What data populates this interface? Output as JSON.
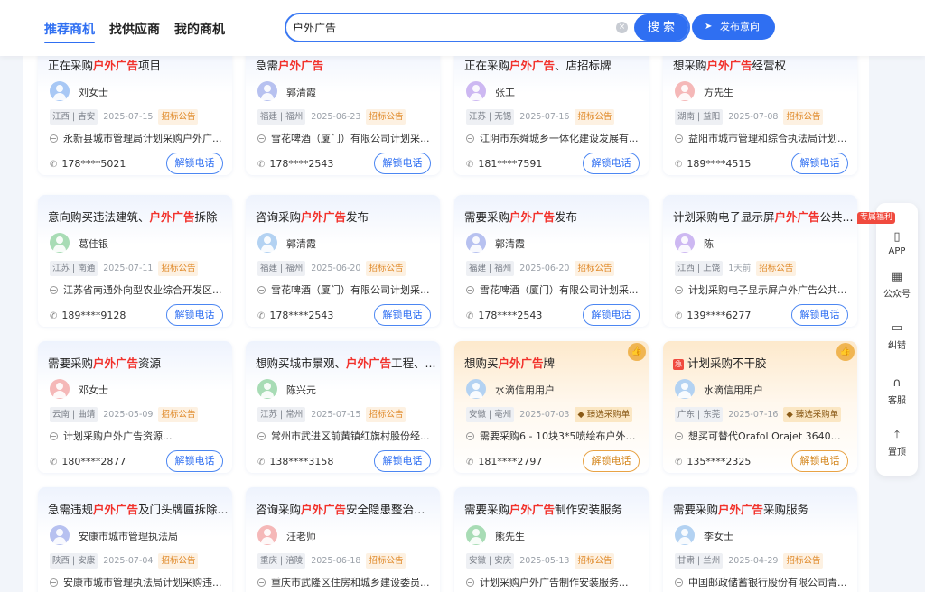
{
  "nav": {
    "tabs": [
      "推荐商机",
      "找供应商",
      "我的商机"
    ]
  },
  "search": {
    "value": "户外广告",
    "clear_icon": "×",
    "button_label": "搜 索"
  },
  "publish": {
    "label": "发布意向",
    "icon": "paper-plane-icon"
  },
  "keyword": "户外广告",
  "cards": [
    {
      "title_pre": "正在采购",
      "title_post": "项目",
      "name": "刘女士",
      "location": "江西 | 吉安",
      "date": "2025-07-15",
      "tag": "招标公告",
      "org": "永新县城市管理局计划采购户外广...",
      "phone": "178****5021",
      "button": "解锁电话",
      "avatar_color": "#a8c8f5"
    },
    {
      "title_pre": "急需",
      "title_post": "",
      "name": "郭清霞",
      "location": "福建 | 福州",
      "date": "2025-06-23",
      "tag": "招标公告",
      "org": "雪花啤酒（厦门）有限公司计划采...",
      "phone": "178****2543",
      "button": "解锁电话",
      "avatar_color": "#b7c1f0"
    },
    {
      "title_pre": "正在采购",
      "title_post": "、店招标牌",
      "name": "张工",
      "location": "江苏 | 无锡",
      "date": "2025-07-16",
      "tag": "招标公告",
      "org": "江阴市东舜城乡一体化建设发展有...",
      "phone": "181****7591",
      "button": "解锁电话",
      "avatar_color": "#cdb8f2"
    },
    {
      "title_pre": "想采购",
      "title_post": "经营权",
      "name": "方先生",
      "location": "湖南 | 益阳",
      "date": "2025-07-08",
      "tag": "招标公告",
      "org": "益阳市城市管理和综合执法局计划...",
      "phone": "189****4515",
      "button": "解锁电话",
      "avatar_color": "#f5b8b8"
    },
    {
      "title_pre": "意向购买违法建筑、",
      "title_post": "拆除",
      "name": "葛佳银",
      "location": "江苏 | 南通",
      "date": "2025-07-11",
      "tag": "招标公告",
      "org": "江苏省南通外向型农业综合开发区...",
      "phone": "189****9128",
      "button": "解锁电话",
      "avatar_color": "#a8dcb5"
    },
    {
      "title_pre": "咨询采购",
      "title_post": "发布",
      "name": "郭清霞",
      "location": "福建 | 福州",
      "date": "2025-06-20",
      "tag": "招标公告",
      "org": "雪花啤酒（厦门）有限公司计划采...",
      "phone": "178****2543",
      "button": "解锁电话",
      "avatar_color": "#b3d2f2"
    },
    {
      "title_pre": "需要采购",
      "title_post": "发布",
      "name": "郭清霞",
      "location": "福建 | 福州",
      "date": "2025-06-20",
      "tag": "招标公告",
      "org": "雪花啤酒（厦门）有限公司计划采...",
      "phone": "178****2543",
      "button": "解锁电话",
      "avatar_color": "#b7c1f0"
    },
    {
      "title_pre": "计划采购电子显示屏",
      "title_post": "公共...",
      "name": "陈",
      "location": "江西 | 上饶",
      "date": "1天前",
      "tag": "招标公告",
      "org": "计划采购电子显示屏户外广告公共...",
      "phone": "139****6277",
      "button": "解锁电话",
      "avatar_color": "#cdb8f2"
    },
    {
      "title_pre": "需要采购",
      "title_post": "资源",
      "name": "邓女士",
      "location": "云南 | 曲靖",
      "date": "2025-05-09",
      "tag": "招标公告",
      "org": "计划采购户外广告资源...",
      "phone": "180****2877",
      "button": "解锁电话",
      "avatar_color": "#f5b8b8"
    },
    {
      "title_pre": "想购买城市景观、",
      "title_post": "工程、...",
      "name": "陈兴元",
      "location": "江苏 | 常州",
      "date": "2025-07-15",
      "tag": "招标公告",
      "org": "常州市武进区前黄镇红旗村股份经...",
      "phone": "138****3158",
      "button": "解锁电话",
      "avatar_color": "#a8dcb5"
    },
    {
      "title_pre": "想购买",
      "title_post": "牌",
      "name": "水滴信用用户",
      "location": "安徽 | 亳州",
      "date": "2025-07-03",
      "tag": "臻选采购单",
      "org": "需要采购6 - 10块3*5喷绘布户外广...",
      "phone": "181****2797",
      "button": "解锁电话",
      "avatar_color": "#b3d2f2"
    },
    {
      "title_pre": "计划采购不干胶",
      "title_post": "",
      "name": "水滴信用用户",
      "location": "广东 | 东莞",
      "date": "2025-07-16",
      "tag": "臻选采购单",
      "org": "想买可替代Orafol Orajet 3640的不...",
      "phone": "135****2325",
      "button": "解锁电话",
      "avatar_color": "#b3d2f2"
    },
    {
      "title_pre": "急需违规",
      "title_post": "及门头牌匾拆除...",
      "name": "安康市城市管理执法局",
      "location": "陕西 | 安康",
      "date": "2025-07-04",
      "tag": "招标公告",
      "org": "安康市城市管理执法局计划采购违...",
      "phone": "",
      "button": "",
      "avatar_color": "#b7c1f0"
    },
    {
      "title_pre": "咨询采购",
      "title_post": "安全隐患整治工程",
      "name": "汪老师",
      "location": "重庆 | 涪陵",
      "date": "2025-06-18",
      "tag": "招标公告",
      "org": "重庆市武隆区住房和城乡建设委员...",
      "phone": "",
      "button": "",
      "avatar_color": "#f5b8b8"
    },
    {
      "title_pre": "需要采购",
      "title_post": "制作安装服务",
      "name": "熊先生",
      "location": "安徽 | 安庆",
      "date": "2025-05-13",
      "tag": "招标公告",
      "org": "计划采购户外广告制作安装服务...",
      "phone": "",
      "button": "",
      "avatar_color": "#a8dcb5"
    },
    {
      "title_pre": "需要采购",
      "title_post": "采购服务",
      "name": "李女士",
      "location": "甘肃 | 兰州",
      "date": "2025-04-29",
      "tag": "招标公告",
      "org": "中国邮政储蓄银行股份有限公司青...",
      "phone": "",
      "button": "",
      "avatar_color": "#b3d2f2"
    }
  ],
  "premium_badge_icon": "thumbs-up-icon",
  "new_tag_icon": "new-tag-icon",
  "new_tag_text": "急",
  "sidebar": {
    "badge": "专属福利",
    "items": [
      {
        "label": "APP",
        "icon": "phone-icon",
        "glyph": "▯"
      },
      {
        "label": "公众号",
        "icon": "qrcode-icon",
        "glyph": "▦"
      },
      {
        "label": "纠错",
        "icon": "feedback-icon",
        "glyph": "▭"
      },
      {
        "label": "客服",
        "icon": "headset-icon",
        "glyph": "∩"
      },
      {
        "label": "置顶",
        "icon": "top-arrow-icon",
        "glyph": "⤒"
      }
    ]
  }
}
